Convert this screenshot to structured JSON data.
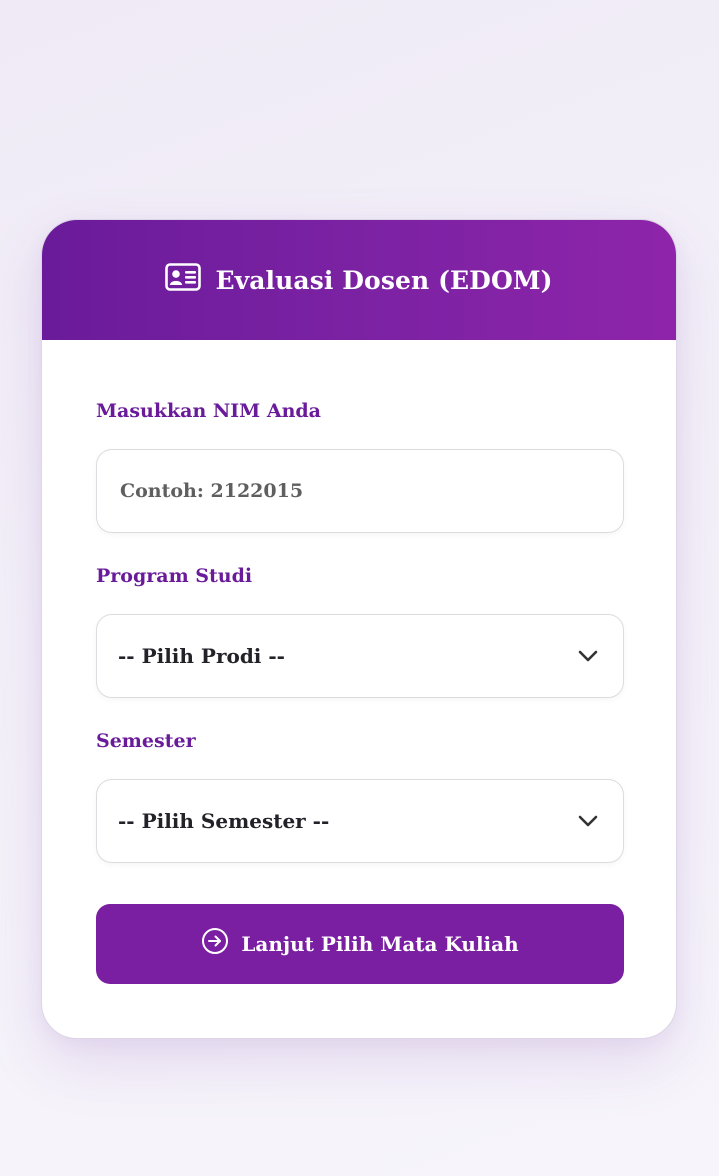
{
  "header": {
    "title": "Evaluasi Dosen (EDOM)",
    "icon": "id-card-icon"
  },
  "form": {
    "nim": {
      "label": "Masukkan NIM Anda",
      "placeholder": "Contoh: 2122015",
      "value": ""
    },
    "prodi": {
      "label": "Program Studi",
      "selected": "-- Pilih Prodi --"
    },
    "semester": {
      "label": "Semester",
      "selected": "-- Pilih Semester --"
    },
    "submit": {
      "label": "Lanjut Pilih Mata Kuliah",
      "icon": "arrow-circle-right-icon"
    }
  },
  "colors": {
    "primary": "#7b1fa2",
    "header_start": "#6a1b9a",
    "header_end": "#8e24aa",
    "label": "#6a1b9a"
  }
}
